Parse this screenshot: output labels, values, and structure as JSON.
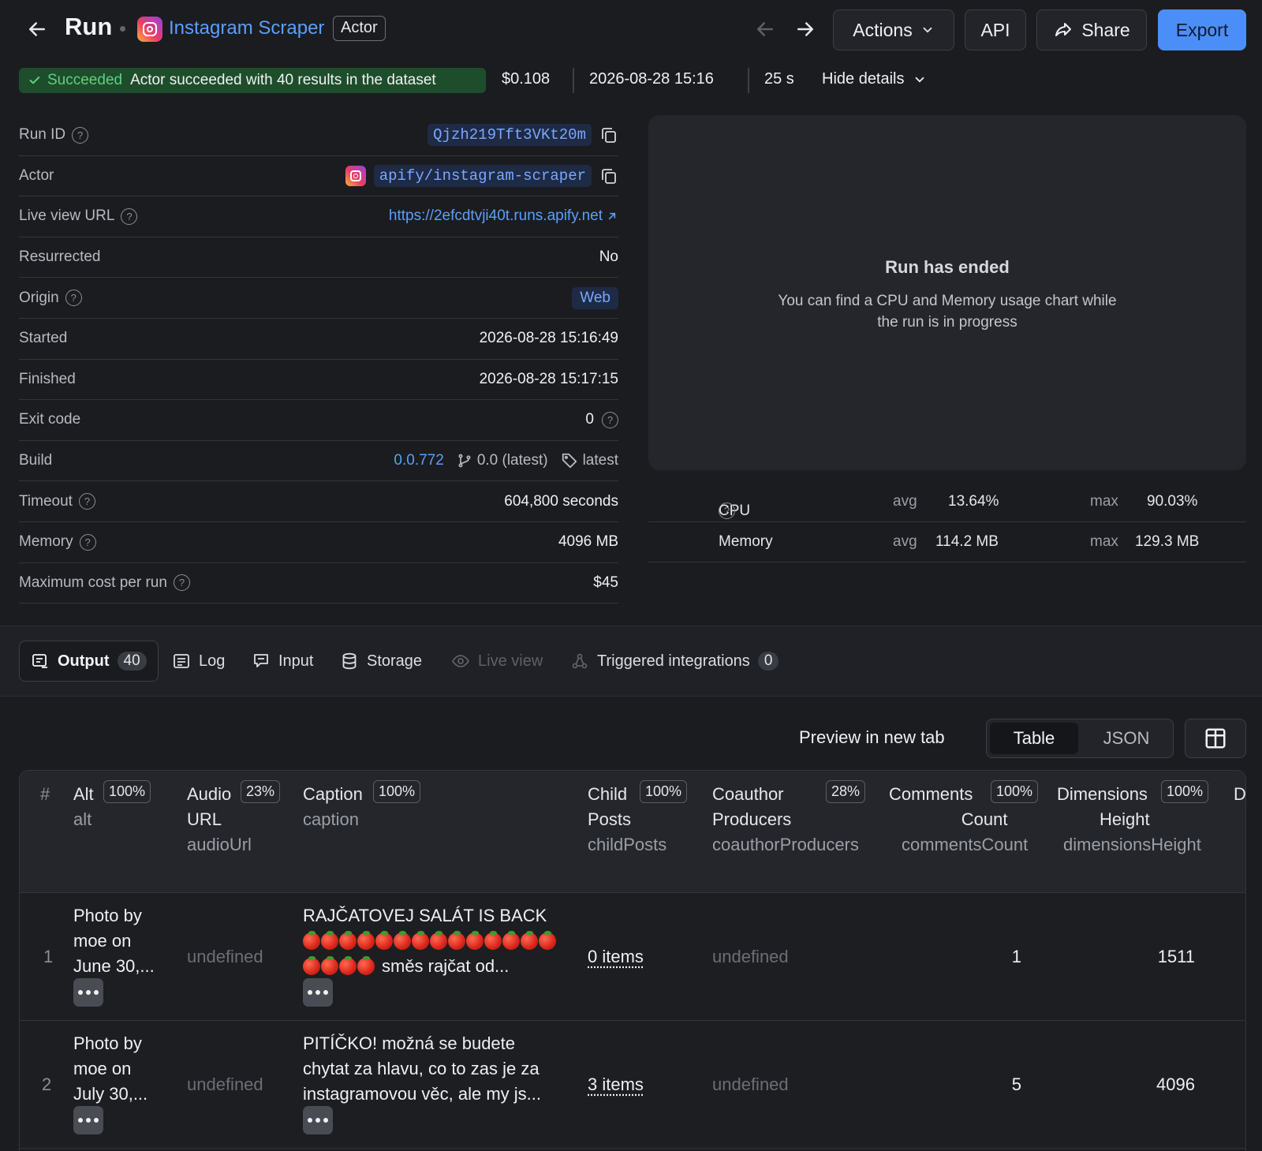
{
  "header": {
    "title": "Run",
    "actor_name": "Instagram Scraper",
    "actor_badge": "Actor",
    "buttons": {
      "actions": "Actions",
      "api": "API",
      "share": "Share",
      "export": "Export"
    }
  },
  "status": {
    "state": "Succeeded",
    "message": "Actor succeeded with 40 results in the dataset",
    "cost": "$0.108",
    "datetime": "2026-08-28 15:16",
    "duration": "25 s",
    "hide_details": "Hide details"
  },
  "details": {
    "run_id": {
      "label": "Run ID",
      "value": "Qjzh219Tft3VKt20m"
    },
    "actor": {
      "label": "Actor",
      "value": "apify/instagram-scraper"
    },
    "live_view_url": {
      "label": "Live view URL",
      "value": "https://2efcdtvji40t.runs.apify.net"
    },
    "resurrected": {
      "label": "Resurrected",
      "value": "No"
    },
    "origin": {
      "label": "Origin",
      "value": "Web"
    },
    "started": {
      "label": "Started",
      "value": "2026-08-28 15:16:49"
    },
    "finished": {
      "label": "Finished",
      "value": "2026-08-28 15:17:15"
    },
    "exit_code": {
      "label": "Exit code",
      "value": "0"
    },
    "build": {
      "label": "Build",
      "version": "0.0.772",
      "branch": "0.0 (latest)",
      "tag": "latest"
    },
    "timeout": {
      "label": "Timeout",
      "value": "604,800 seconds"
    },
    "memory": {
      "label": "Memory",
      "value": "4096 MB"
    },
    "max_cost": {
      "label": "Maximum cost per run",
      "value": "$45"
    }
  },
  "usage_panel": {
    "title": "Run has ended",
    "subtitle": "You can find a CPU and Memory usage chart while the run is in progress",
    "cpu": {
      "label": "CPU",
      "avg_label": "avg",
      "avg": "13.64%",
      "max_label": "max",
      "max": "90.03%"
    },
    "memory": {
      "label": "Memory",
      "avg_label": "avg",
      "avg": "114.2 MB",
      "max_label": "max",
      "max": "129.3 MB"
    }
  },
  "tabs": [
    {
      "label": "Output",
      "count": "40"
    },
    {
      "label": "Log"
    },
    {
      "label": "Input"
    },
    {
      "label": "Storage"
    },
    {
      "label": "Live view"
    },
    {
      "label": "Triggered integrations",
      "count": "0"
    }
  ],
  "output_toolbar": {
    "preview": "Preview in new tab",
    "view_table": "Table",
    "view_json": "JSON"
  },
  "table": {
    "columns": [
      {
        "hash": "#"
      },
      {
        "line1": "Alt",
        "line2": "",
        "key": "alt",
        "pct": "100%"
      },
      {
        "line1": "Audio",
        "line2": "URL",
        "key": "audioUrl",
        "pct": "23%"
      },
      {
        "line1": "Caption",
        "line2": "",
        "key": "caption",
        "pct": "100%"
      },
      {
        "line1": "Child",
        "line2": "Posts",
        "key": "childPosts",
        "pct": "100%"
      },
      {
        "line1": "Coauthor",
        "line2": "Producers",
        "key": "coauthorProducers",
        "pct": "28%"
      },
      {
        "line1": "Comments",
        "line2": "Count",
        "key": "commentsCount",
        "pct": "100%"
      },
      {
        "line1": "Dimensions",
        "line2": "Height",
        "key": "dimensionsHeight",
        "pct": "100%"
      },
      {
        "line1": "D"
      }
    ],
    "rows": [
      {
        "index": "1",
        "alt": [
          "Photo by",
          "moe on",
          "June 30,..."
        ],
        "audio": "undefined",
        "caption": [
          "RAJČATOVEJ SALÁT IS BACK",
          "směs rajčat od..."
        ],
        "child": "0 items",
        "coauthor": "undefined",
        "comments": "1",
        "height": "1511"
      },
      {
        "index": "2",
        "alt": [
          "Photo by",
          "moe on",
          "July 30,..."
        ],
        "audio": "undefined",
        "caption": [
          "PITÍČKO! možná se budete",
          "chytat za hlavu, co to zas je za",
          "instagramovou věc, ale my js..."
        ],
        "child": "3 items",
        "coauthor": "undefined",
        "comments": "5",
        "height": "4096"
      }
    ]
  }
}
